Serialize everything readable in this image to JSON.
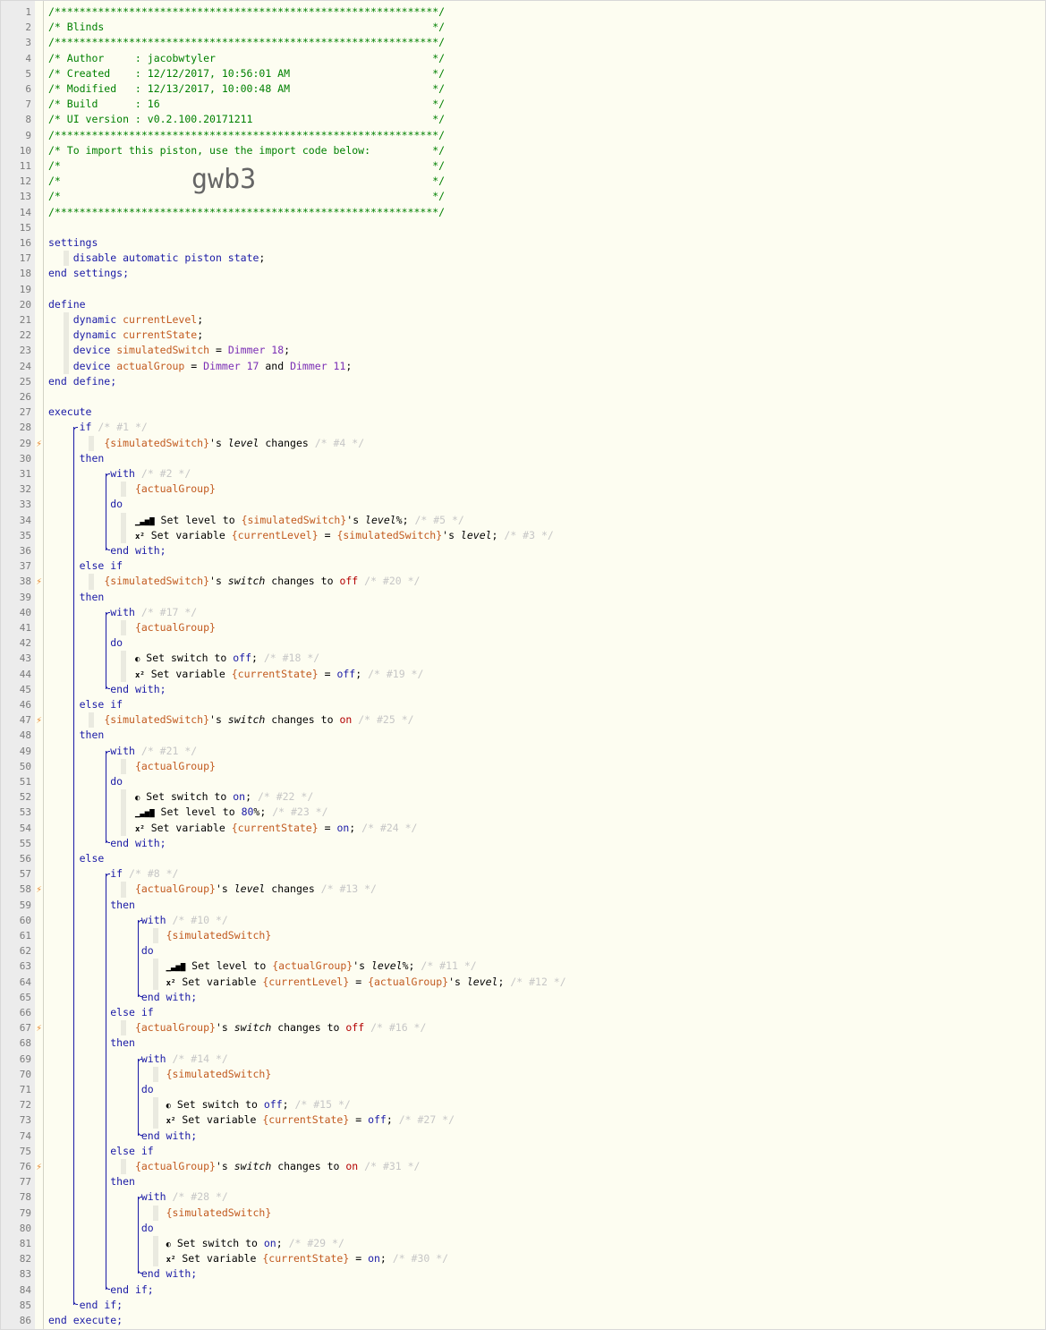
{
  "import_code": "gwb3",
  "line_numbers": [
    "1",
    "2",
    "3",
    "4",
    "5",
    "6",
    "7",
    "8",
    "9",
    "10",
    "11",
    "12",
    "13",
    "14",
    "15",
    "16",
    "17",
    "18",
    "19",
    "20",
    "21",
    "22",
    "23",
    "24",
    "25",
    "26",
    "27",
    "28",
    "29",
    "30",
    "31",
    "32",
    "33",
    "34",
    "35",
    "36",
    "37",
    "38",
    "39",
    "40",
    "41",
    "42",
    "43",
    "44",
    "45",
    "46",
    "47",
    "48",
    "49",
    "50",
    "51",
    "52",
    "53",
    "54",
    "55",
    "56",
    "57",
    "58",
    "59",
    "60",
    "61",
    "62",
    "63",
    "64",
    "65",
    "66",
    "67",
    "68",
    "69",
    "70",
    "71",
    "72",
    "73",
    "74",
    "75",
    "76",
    "77",
    "78",
    "79",
    "80",
    "81",
    "82",
    "83",
    "84",
    "85",
    "86"
  ],
  "trigger_lines": [
    29,
    38,
    47,
    58,
    67,
    76
  ],
  "lines": [
    [
      {
        "t": "/**************************************************************/",
        "c": "cm"
      }
    ],
    [
      {
        "t": "/* Blinds                                                     */",
        "c": "cm"
      }
    ],
    [
      {
        "t": "/**************************************************************/",
        "c": "cm"
      }
    ],
    [
      {
        "t": "/* Author     : jacobwtyler                                   */",
        "c": "cm"
      }
    ],
    [
      {
        "t": "/* Created    : 12/12/2017, 10:56:01 AM                       */",
        "c": "cm"
      }
    ],
    [
      {
        "t": "/* Modified   : 12/13/2017, 10:00:48 AM                       */",
        "c": "cm"
      }
    ],
    [
      {
        "t": "/* Build      : 16                                            */",
        "c": "cm"
      }
    ],
    [
      {
        "t": "/* UI version : v0.2.100.20171211                             */",
        "c": "cm"
      }
    ],
    [
      {
        "t": "/**************************************************************/",
        "c": "cm"
      }
    ],
    [
      {
        "t": "/* To import this piston, use the import code below:          */",
        "c": "cm"
      }
    ],
    [
      {
        "t": "/*                                                            */",
        "c": "cm"
      }
    ],
    [
      {
        "t": "/*                                                            */",
        "c": "cm"
      }
    ],
    [
      {
        "t": "/*                                                            */",
        "c": "cm"
      }
    ],
    [
      {
        "t": "/**************************************************************/",
        "c": "cm"
      }
    ],
    [],
    [
      {
        "t": "settings",
        "c": "kw"
      }
    ],
    [
      {
        "t": "    "
      },
      {
        "t": "disable automatic piston state",
        "c": "kw"
      },
      {
        "t": ";"
      }
    ],
    [
      {
        "t": "end settings;",
        "c": "kw"
      }
    ],
    [],
    [
      {
        "t": "define",
        "c": "kw"
      }
    ],
    [
      {
        "t": "    "
      },
      {
        "t": "dynamic",
        "c": "kw"
      },
      {
        "t": " "
      },
      {
        "t": "currentLevel",
        "c": "var"
      },
      {
        "t": ";"
      }
    ],
    [
      {
        "t": "    "
      },
      {
        "t": "dynamic",
        "c": "kw"
      },
      {
        "t": " "
      },
      {
        "t": "currentState",
        "c": "var"
      },
      {
        "t": ";"
      }
    ],
    [
      {
        "t": "    "
      },
      {
        "t": "device",
        "c": "kw"
      },
      {
        "t": " "
      },
      {
        "t": "simulatedSwitch",
        "c": "var"
      },
      {
        "t": " = "
      },
      {
        "t": "Dimmer 18",
        "c": "dev"
      },
      {
        "t": ";"
      }
    ],
    [
      {
        "t": "    "
      },
      {
        "t": "device",
        "c": "kw"
      },
      {
        "t": " "
      },
      {
        "t": "actualGroup",
        "c": "var"
      },
      {
        "t": " = "
      },
      {
        "t": "Dimmer 17",
        "c": "dev"
      },
      {
        "t": " and "
      },
      {
        "t": "Dimmer 11",
        "c": "dev"
      },
      {
        "t": ";"
      }
    ],
    [
      {
        "t": "end define;",
        "c": "kw"
      }
    ],
    [],
    [
      {
        "t": "execute",
        "c": "kw"
      }
    ],
    [
      {
        "t": "     "
      },
      {
        "t": "if",
        "c": "kw"
      },
      {
        "t": " "
      },
      {
        "t": "/* #1 */",
        "c": "cmg"
      }
    ],
    [
      {
        "t": "         "
      },
      {
        "t": "{simulatedSwitch}",
        "c": "var"
      },
      {
        "t": "'s "
      },
      {
        "t": "level",
        "c": "attr"
      },
      {
        "t": " changes "
      },
      {
        "t": "/* #4 */",
        "c": "cmg"
      }
    ],
    [
      {
        "t": "     "
      },
      {
        "t": "then",
        "c": "kw"
      }
    ],
    [
      {
        "t": "          "
      },
      {
        "t": "with",
        "c": "kw"
      },
      {
        "t": " "
      },
      {
        "t": "/* #2 */",
        "c": "cmg"
      }
    ],
    [
      {
        "t": "              "
      },
      {
        "t": "{actualGroup}",
        "c": "var"
      }
    ],
    [
      {
        "t": "          "
      },
      {
        "t": "do",
        "c": "kw"
      }
    ],
    [
      {
        "t": "              "
      },
      {
        "t": "▁▃▅▇",
        "c": "ico"
      },
      {
        "t": " Set level to "
      },
      {
        "t": "{simulatedSwitch}",
        "c": "var"
      },
      {
        "t": "'s "
      },
      {
        "t": "level",
        "c": "attr"
      },
      {
        "t": "%; "
      },
      {
        "t": "/* #5 */",
        "c": "cmg"
      }
    ],
    [
      {
        "t": "              "
      },
      {
        "t": "x²",
        "c": "ico"
      },
      {
        "t": " Set variable "
      },
      {
        "t": "{currentLevel}",
        "c": "var"
      },
      {
        "t": " = "
      },
      {
        "t": "{simulatedSwitch}",
        "c": "var"
      },
      {
        "t": "'s "
      },
      {
        "t": "level",
        "c": "attr"
      },
      {
        "t": "; "
      },
      {
        "t": "/* #3 */",
        "c": "cmg"
      }
    ],
    [
      {
        "t": "          "
      },
      {
        "t": "end with;",
        "c": "kw"
      }
    ],
    [
      {
        "t": "     "
      },
      {
        "t": "else if",
        "c": "kw"
      }
    ],
    [
      {
        "t": "         "
      },
      {
        "t": "{simulatedSwitch}",
        "c": "var"
      },
      {
        "t": "'s "
      },
      {
        "t": "switch",
        "c": "attr"
      },
      {
        "t": " changes to "
      },
      {
        "t": "off",
        "c": "red"
      },
      {
        "t": " "
      },
      {
        "t": "/* #20 */",
        "c": "cmg"
      }
    ],
    [
      {
        "t": "     "
      },
      {
        "t": "then",
        "c": "kw"
      }
    ],
    [
      {
        "t": "          "
      },
      {
        "t": "with",
        "c": "kw"
      },
      {
        "t": " "
      },
      {
        "t": "/* #17 */",
        "c": "cmg"
      }
    ],
    [
      {
        "t": "              "
      },
      {
        "t": "{actualGroup}",
        "c": "var"
      }
    ],
    [
      {
        "t": "          "
      },
      {
        "t": "do",
        "c": "kw"
      }
    ],
    [
      {
        "t": "              "
      },
      {
        "t": "◐",
        "c": "ico"
      },
      {
        "t": " Set switch to "
      },
      {
        "t": "off",
        "c": "val"
      },
      {
        "t": "; "
      },
      {
        "t": "/* #18 */",
        "c": "cmg"
      }
    ],
    [
      {
        "t": "              "
      },
      {
        "t": "x²",
        "c": "ico"
      },
      {
        "t": " Set variable "
      },
      {
        "t": "{currentState}",
        "c": "var"
      },
      {
        "t": " = "
      },
      {
        "t": "off",
        "c": "val"
      },
      {
        "t": "; "
      },
      {
        "t": "/* #19 */",
        "c": "cmg"
      }
    ],
    [
      {
        "t": "          "
      },
      {
        "t": "end with;",
        "c": "kw"
      }
    ],
    [
      {
        "t": "     "
      },
      {
        "t": "else if",
        "c": "kw"
      }
    ],
    [
      {
        "t": "         "
      },
      {
        "t": "{simulatedSwitch}",
        "c": "var"
      },
      {
        "t": "'s "
      },
      {
        "t": "switch",
        "c": "attr"
      },
      {
        "t": " changes to "
      },
      {
        "t": "on",
        "c": "red"
      },
      {
        "t": " "
      },
      {
        "t": "/* #25 */",
        "c": "cmg"
      }
    ],
    [
      {
        "t": "     "
      },
      {
        "t": "then",
        "c": "kw"
      }
    ],
    [
      {
        "t": "          "
      },
      {
        "t": "with",
        "c": "kw"
      },
      {
        "t": " "
      },
      {
        "t": "/* #21 */",
        "c": "cmg"
      }
    ],
    [
      {
        "t": "              "
      },
      {
        "t": "{actualGroup}",
        "c": "var"
      }
    ],
    [
      {
        "t": "          "
      },
      {
        "t": "do",
        "c": "kw"
      }
    ],
    [
      {
        "t": "              "
      },
      {
        "t": "◐",
        "c": "ico"
      },
      {
        "t": " Set switch to "
      },
      {
        "t": "on",
        "c": "val"
      },
      {
        "t": "; "
      },
      {
        "t": "/* #22 */",
        "c": "cmg"
      }
    ],
    [
      {
        "t": "              "
      },
      {
        "t": "▁▃▅▇",
        "c": "ico"
      },
      {
        "t": " Set level to "
      },
      {
        "t": "80",
        "c": "num"
      },
      {
        "t": "%; "
      },
      {
        "t": "/* #23 */",
        "c": "cmg"
      }
    ],
    [
      {
        "t": "              "
      },
      {
        "t": "x²",
        "c": "ico"
      },
      {
        "t": " Set variable "
      },
      {
        "t": "{currentState}",
        "c": "var"
      },
      {
        "t": " = "
      },
      {
        "t": "on",
        "c": "val"
      },
      {
        "t": "; "
      },
      {
        "t": "/* #24 */",
        "c": "cmg"
      }
    ],
    [
      {
        "t": "          "
      },
      {
        "t": "end with;",
        "c": "kw"
      }
    ],
    [
      {
        "t": "     "
      },
      {
        "t": "else",
        "c": "kw"
      }
    ],
    [
      {
        "t": "          "
      },
      {
        "t": "if",
        "c": "kw"
      },
      {
        "t": " "
      },
      {
        "t": "/* #8 */",
        "c": "cmg"
      }
    ],
    [
      {
        "t": "              "
      },
      {
        "t": "{actualGroup}",
        "c": "var"
      },
      {
        "t": "'s "
      },
      {
        "t": "level",
        "c": "attr"
      },
      {
        "t": " changes "
      },
      {
        "t": "/* #13 */",
        "c": "cmg"
      }
    ],
    [
      {
        "t": "          "
      },
      {
        "t": "then",
        "c": "kw"
      }
    ],
    [
      {
        "t": "               "
      },
      {
        "t": "with",
        "c": "kw"
      },
      {
        "t": " "
      },
      {
        "t": "/* #10 */",
        "c": "cmg"
      }
    ],
    [
      {
        "t": "                   "
      },
      {
        "t": "{simulatedSwitch}",
        "c": "var"
      }
    ],
    [
      {
        "t": "               "
      },
      {
        "t": "do",
        "c": "kw"
      }
    ],
    [
      {
        "t": "                   "
      },
      {
        "t": "▁▃▅▇",
        "c": "ico"
      },
      {
        "t": " Set level to "
      },
      {
        "t": "{actualGroup}",
        "c": "var"
      },
      {
        "t": "'s "
      },
      {
        "t": "level",
        "c": "attr"
      },
      {
        "t": "%; "
      },
      {
        "t": "/* #11 */",
        "c": "cmg"
      }
    ],
    [
      {
        "t": "                   "
      },
      {
        "t": "x²",
        "c": "ico"
      },
      {
        "t": " Set variable "
      },
      {
        "t": "{currentLevel}",
        "c": "var"
      },
      {
        "t": " = "
      },
      {
        "t": "{actualGroup}",
        "c": "var"
      },
      {
        "t": "'s "
      },
      {
        "t": "level",
        "c": "attr"
      },
      {
        "t": "; "
      },
      {
        "t": "/* #12 */",
        "c": "cmg"
      }
    ],
    [
      {
        "t": "               "
      },
      {
        "t": "end with;",
        "c": "kw"
      }
    ],
    [
      {
        "t": "          "
      },
      {
        "t": "else if",
        "c": "kw"
      }
    ],
    [
      {
        "t": "              "
      },
      {
        "t": "{actualGroup}",
        "c": "var"
      },
      {
        "t": "'s "
      },
      {
        "t": "switch",
        "c": "attr"
      },
      {
        "t": " changes to "
      },
      {
        "t": "off",
        "c": "red"
      },
      {
        "t": " "
      },
      {
        "t": "/* #16 */",
        "c": "cmg"
      }
    ],
    [
      {
        "t": "          "
      },
      {
        "t": "then",
        "c": "kw"
      }
    ],
    [
      {
        "t": "               "
      },
      {
        "t": "with",
        "c": "kw"
      },
      {
        "t": " "
      },
      {
        "t": "/* #14 */",
        "c": "cmg"
      }
    ],
    [
      {
        "t": "                   "
      },
      {
        "t": "{simulatedSwitch}",
        "c": "var"
      }
    ],
    [
      {
        "t": "               "
      },
      {
        "t": "do",
        "c": "kw"
      }
    ],
    [
      {
        "t": "                   "
      },
      {
        "t": "◐",
        "c": "ico"
      },
      {
        "t": " Set switch to "
      },
      {
        "t": "off",
        "c": "val"
      },
      {
        "t": "; "
      },
      {
        "t": "/* #15 */",
        "c": "cmg"
      }
    ],
    [
      {
        "t": "                   "
      },
      {
        "t": "x²",
        "c": "ico"
      },
      {
        "t": " Set variable "
      },
      {
        "t": "{currentState}",
        "c": "var"
      },
      {
        "t": " = "
      },
      {
        "t": "off",
        "c": "val"
      },
      {
        "t": "; "
      },
      {
        "t": "/* #27 */",
        "c": "cmg"
      }
    ],
    [
      {
        "t": "               "
      },
      {
        "t": "end with;",
        "c": "kw"
      }
    ],
    [
      {
        "t": "          "
      },
      {
        "t": "else if",
        "c": "kw"
      }
    ],
    [
      {
        "t": "              "
      },
      {
        "t": "{actualGroup}",
        "c": "var"
      },
      {
        "t": "'s "
      },
      {
        "t": "switch",
        "c": "attr"
      },
      {
        "t": " changes to "
      },
      {
        "t": "on",
        "c": "red"
      },
      {
        "t": " "
      },
      {
        "t": "/* #31 */",
        "c": "cmg"
      }
    ],
    [
      {
        "t": "          "
      },
      {
        "t": "then",
        "c": "kw"
      }
    ],
    [
      {
        "t": "               "
      },
      {
        "t": "with",
        "c": "kw"
      },
      {
        "t": " "
      },
      {
        "t": "/* #28 */",
        "c": "cmg"
      }
    ],
    [
      {
        "t": "                   "
      },
      {
        "t": "{simulatedSwitch}",
        "c": "var"
      }
    ],
    [
      {
        "t": "               "
      },
      {
        "t": "do",
        "c": "kw"
      }
    ],
    [
      {
        "t": "                   "
      },
      {
        "t": "◐",
        "c": "ico"
      },
      {
        "t": " Set switch to "
      },
      {
        "t": "on",
        "c": "val"
      },
      {
        "t": "; "
      },
      {
        "t": "/* #29 */",
        "c": "cmg"
      }
    ],
    [
      {
        "t": "                   "
      },
      {
        "t": "x²",
        "c": "ico"
      },
      {
        "t": " Set variable "
      },
      {
        "t": "{currentState}",
        "c": "var"
      },
      {
        "t": " = "
      },
      {
        "t": "on",
        "c": "val"
      },
      {
        "t": "; "
      },
      {
        "t": "/* #30 */",
        "c": "cmg"
      }
    ],
    [
      {
        "t": "               "
      },
      {
        "t": "end with;",
        "c": "kw"
      }
    ],
    [
      {
        "t": "          "
      },
      {
        "t": "end if;",
        "c": "kw"
      }
    ],
    [
      {
        "t": "     "
      },
      {
        "t": "end if;",
        "c": "kw"
      }
    ],
    [
      {
        "t": "end execute;",
        "c": "kw"
      }
    ]
  ]
}
